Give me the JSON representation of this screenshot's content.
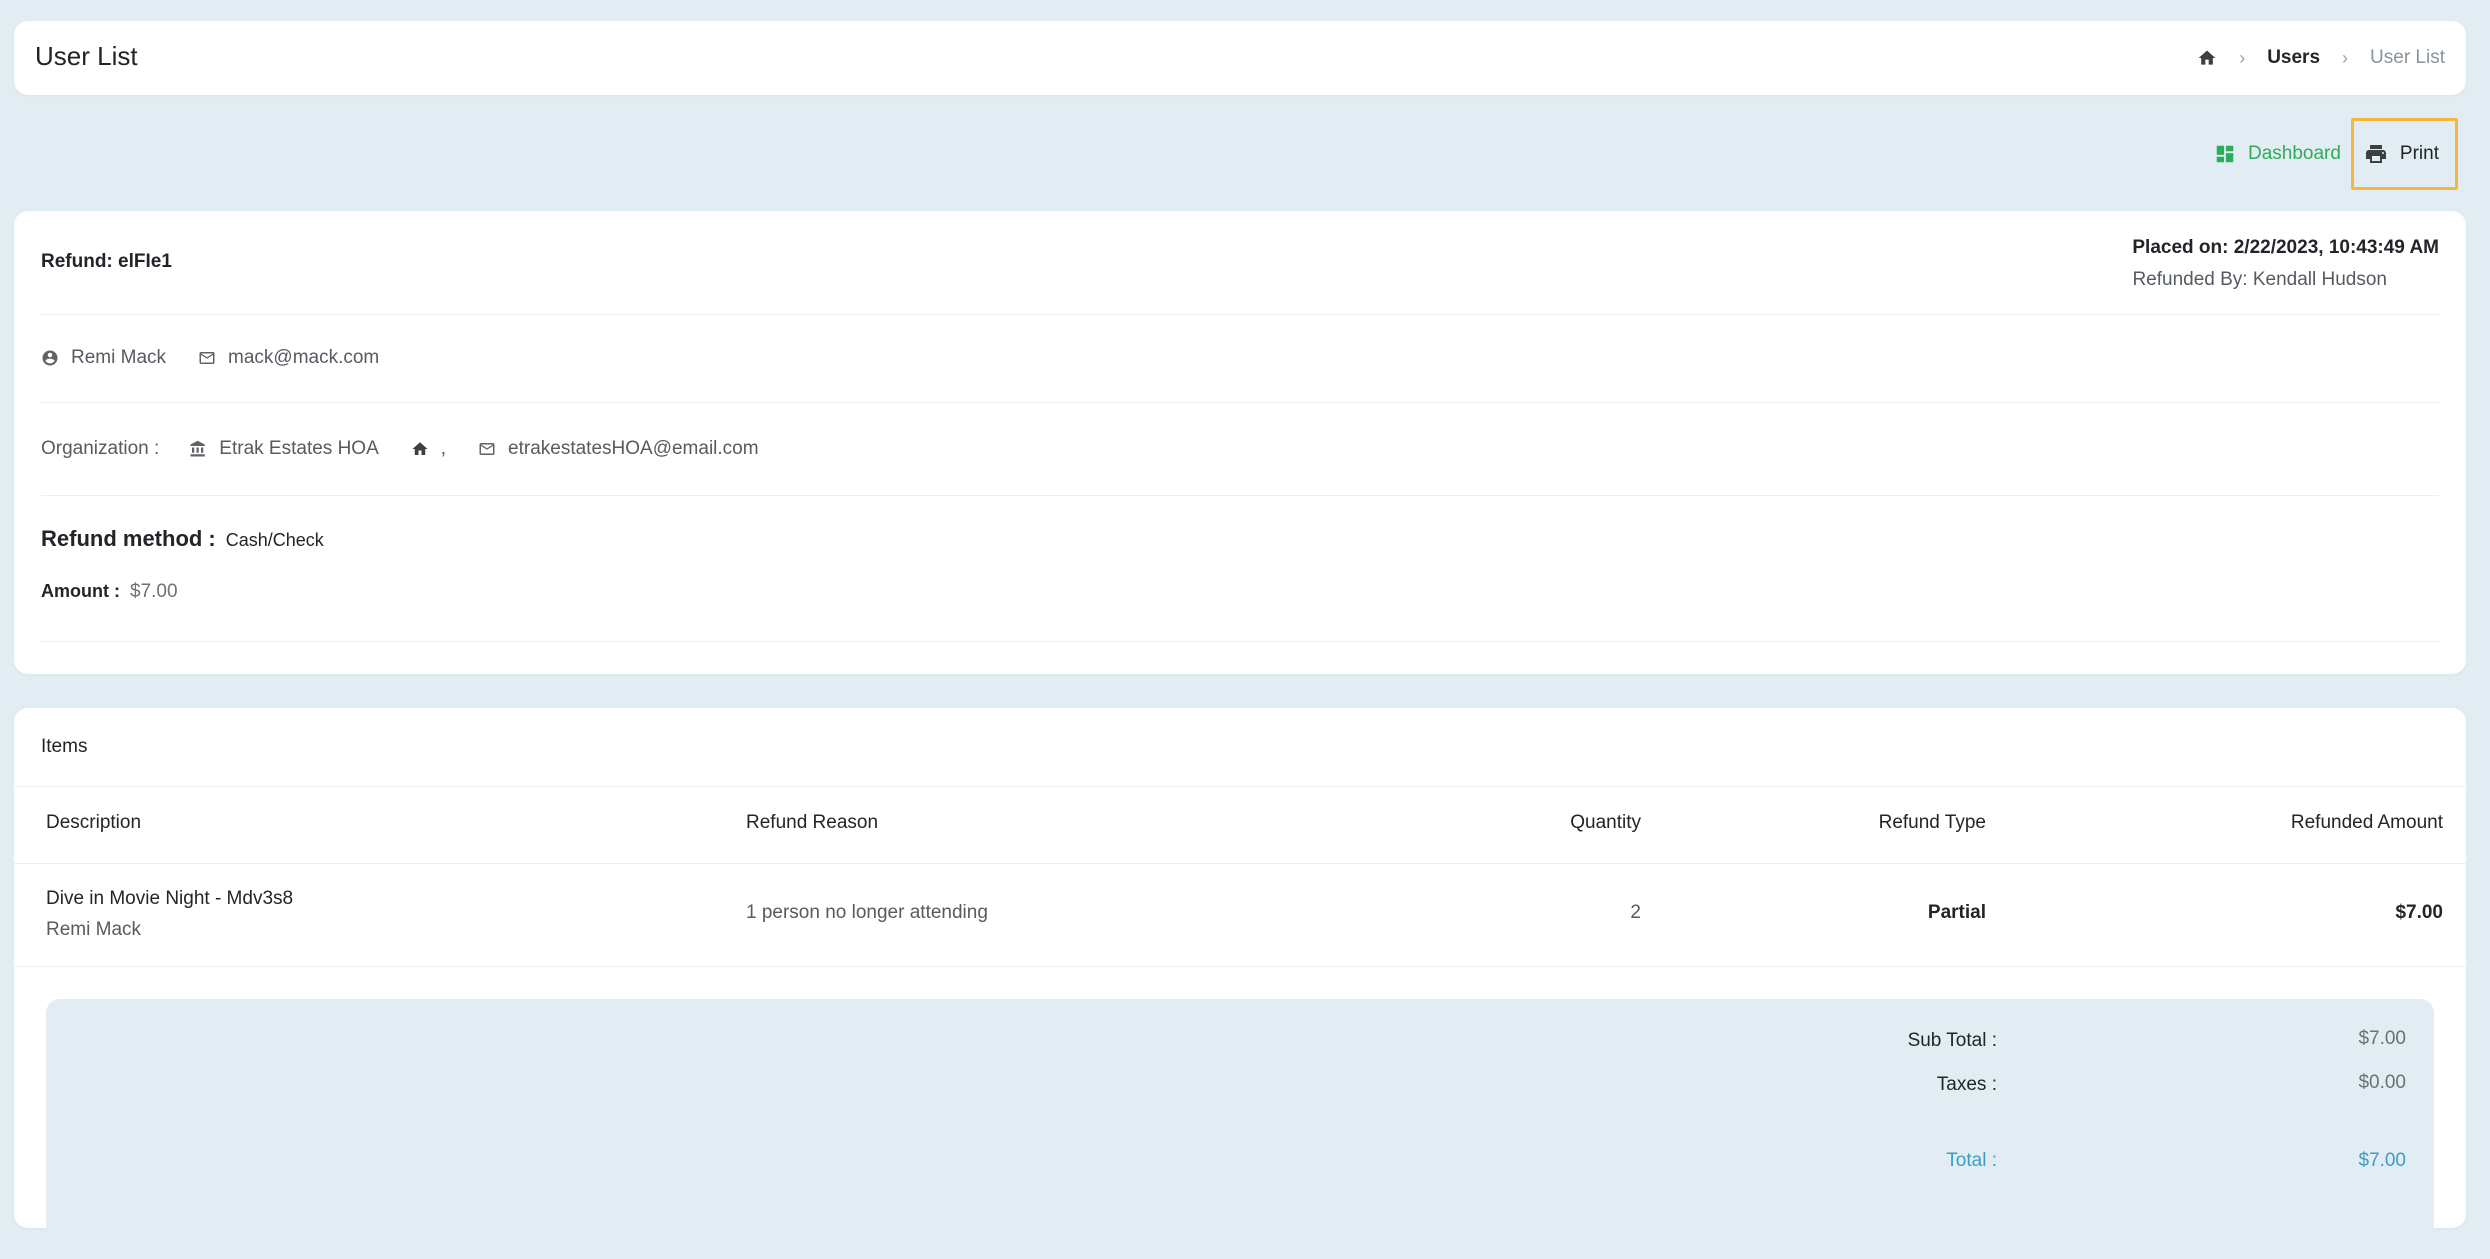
{
  "header": {
    "title": "User List",
    "breadcrumb": {
      "users": "Users",
      "current": "User List"
    }
  },
  "actions": {
    "dashboard_label": "Dashboard",
    "print_label": "Print"
  },
  "refund": {
    "id_label": "Refund: elFIe1",
    "placed_on": "Placed on: 2/22/2023, 10:43:49 AM",
    "refunded_by": "Refunded By: Kendall Hudson",
    "customer_name": "Remi Mack",
    "customer_email": "mack@mack.com",
    "org_label": "Organization :",
    "org_name": "Etrak Estates HOA",
    "org_address": ",",
    "org_email": "etrakestatesHOA@email.com",
    "method_label": "Refund method :",
    "method_value": "Cash/Check",
    "amount_label": "Amount :",
    "amount_value": "$7.00"
  },
  "items": {
    "title": "Items",
    "columns": [
      "Description",
      "Refund Reason",
      "Quantity",
      "Refund Type",
      "Refunded Amount"
    ],
    "rows": [
      {
        "description": "Dive in Movie Night - Mdv3s8",
        "person": "Remi Mack",
        "reason": "1 person no longer attending",
        "quantity": "2",
        "type": "Partial",
        "amount": "$7.00"
      }
    ],
    "summary": {
      "subtotal_label": "Sub Total :",
      "subtotal_value": "$7.00",
      "taxes_label": "Taxes :",
      "taxes_value": "$0.00",
      "total_label": "Total :",
      "total_value": "$7.00"
    }
  },
  "colors": {
    "accent_green": "#2fac5b",
    "highlight_border": "#f6b73c",
    "total_blue": "#3a9ec9",
    "page_bg": "#e1edf2"
  }
}
